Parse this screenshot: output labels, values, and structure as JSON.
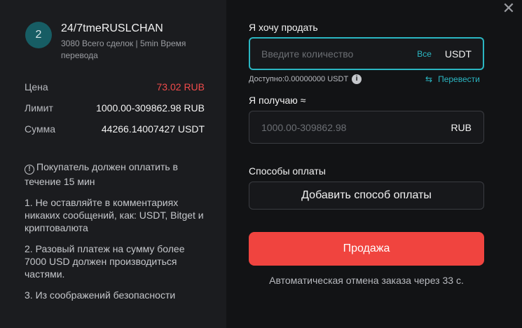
{
  "merchant": {
    "avatar_letter": "2",
    "name": "24/7tmeRUSLCHAN",
    "stats": "3080 Всего сделок | 5min Время перевода"
  },
  "details": {
    "price_label": "Цена",
    "price_value": "73.02 RUB",
    "limit_label": "Лимит",
    "limit_value": "1000.00-309862.98 RUB",
    "amount_label": "Сумма",
    "amount_value": "44266.14007427 USDT"
  },
  "notice": {
    "warning": "Покупатель должен оплатить в течение 15 мин",
    "rules": [
      "1. Не оставляйте в комментариях никаких сообщений, как: USDT, Bitget и криптовалюта",
      "2. Разовый платеж на сумму более 7000 USD должен производиться частями.",
      "3. Из соображений безопасности"
    ]
  },
  "form": {
    "sell_label": "Я хочу продать",
    "sell_placeholder": "Введите количество",
    "sell_all": "Все",
    "sell_unit": "USDT",
    "available": "Доступно:0.00000000 USDT",
    "convert": "Перевести",
    "receive_label": "Я получаю ≈",
    "receive_placeholder": "1000.00-309862.98",
    "receive_unit": "RUB",
    "payment_label": "Способы оплаты",
    "add_payment": "Добавить способ оплаты",
    "submit": "Продажа",
    "auto_cancel": "Автоматическая отмена заказа через 33 с."
  },
  "colors": {
    "accent": "#2bb6c2",
    "sell": "#f0443f",
    "price": "#f04b4b"
  },
  "icons": {
    "close": "close-icon",
    "warning": "warning-circle-icon",
    "info": "info-icon",
    "swap": "swap-arrows-icon"
  }
}
